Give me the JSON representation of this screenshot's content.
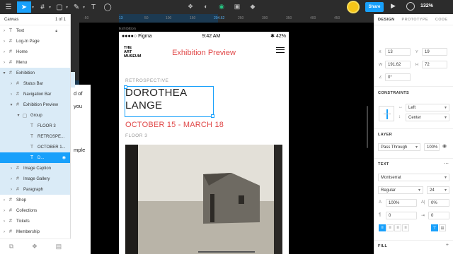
{
  "toolbar": {
    "share_label": "Share",
    "zoom": "132%",
    "accent": "#18a0fb"
  },
  "layers_panel": {
    "canvas_label": "Canvas",
    "page_indicator": "1 of 1",
    "items": [
      {
        "label": "Text",
        "type": "T",
        "indent": 0,
        "arrow": "›"
      },
      {
        "label": "Log-In Page",
        "type": "#",
        "indent": 0,
        "arrow": "›"
      },
      {
        "label": "Home",
        "type": "#",
        "indent": 0,
        "arrow": "›"
      },
      {
        "label": "Menu",
        "type": "#",
        "indent": 0,
        "arrow": "›"
      },
      {
        "label": "Exhibition",
        "type": "#",
        "indent": 0,
        "arrow": "▾"
      },
      {
        "label": "Status Bar",
        "type": "#",
        "indent": 1,
        "arrow": "›"
      },
      {
        "label": "Navigation Bar",
        "type": "#",
        "indent": 1,
        "arrow": "›"
      },
      {
        "label": "Exhibition Preview",
        "type": "#",
        "indent": 1,
        "arrow": "▾"
      },
      {
        "label": "Group",
        "type": "▢",
        "indent": 2,
        "arrow": "▾"
      },
      {
        "label": "FLOOR 3",
        "type": "T",
        "indent": 3,
        "arrow": ""
      },
      {
        "label": "RETROSPE...",
        "type": "T",
        "indent": 3,
        "arrow": ""
      },
      {
        "label": "OCTOBER 1...",
        "type": "T",
        "indent": 3,
        "arrow": ""
      },
      {
        "label": "D...",
        "type": "T",
        "indent": 3,
        "arrow": ""
      },
      {
        "label": "Image Caption",
        "type": "#",
        "indent": 1,
        "arrow": "›"
      },
      {
        "label": "Image Gallery",
        "type": "#",
        "indent": 1,
        "arrow": "›"
      },
      {
        "label": "Paragraph",
        "type": "#",
        "indent": 1,
        "arrow": "›"
      },
      {
        "label": "Shop",
        "type": "#",
        "indent": 0,
        "arrow": "›"
      },
      {
        "label": "Collections",
        "type": "#",
        "indent": 0,
        "arrow": "›"
      },
      {
        "label": "Tickets",
        "type": "#",
        "indent": 0,
        "arrow": "›"
      },
      {
        "label": "Membership",
        "type": "#",
        "indent": 0,
        "arrow": "›"
      }
    ]
  },
  "canvas": {
    "ruler_ticks": [
      "-50",
      "13",
      "50",
      "100",
      "150",
      "204.62",
      "250",
      "300",
      "350",
      "400",
      "450"
    ],
    "frame_label": "Exhibition",
    "left_fragments": [
      "d of",
      "you",
      "mple"
    ]
  },
  "phone": {
    "carrier": "●●●●○ Figma",
    "time": "9:42 AM",
    "battery": "✱ 42%",
    "museum_line1": "THE",
    "museum_line2": "ART",
    "museum_line3": "MUSEUM",
    "title": "Exhibition Preview",
    "retro": "RETROSPECTIVE",
    "name_line1": "DOROTHEA",
    "name_line2": "LANGE",
    "dates": "OCTOBER 15 - MARCH 18",
    "floor": "FLOOR 3",
    "accent_red": "#e04848"
  },
  "properties": {
    "tabs": [
      "DESIGN",
      "PROTOTYPE",
      "CODE"
    ],
    "x": "13",
    "y": "19",
    "w": "191.62",
    "h": "72",
    "rotation": "0°",
    "constraints_title": "CONSTRAINTS",
    "constraint_h": "Left",
    "constraint_v": "Center",
    "layer_title": "LAYER",
    "blend": "Pass Through",
    "opacity": "100%",
    "text_title": "TEXT",
    "font": "Montserrat",
    "weight": "Regular",
    "size": "24",
    "line_height": "100%",
    "letter_spacing": "0%",
    "para_spacing": "0",
    "para_indent": "0",
    "fill_title": "FILL"
  }
}
